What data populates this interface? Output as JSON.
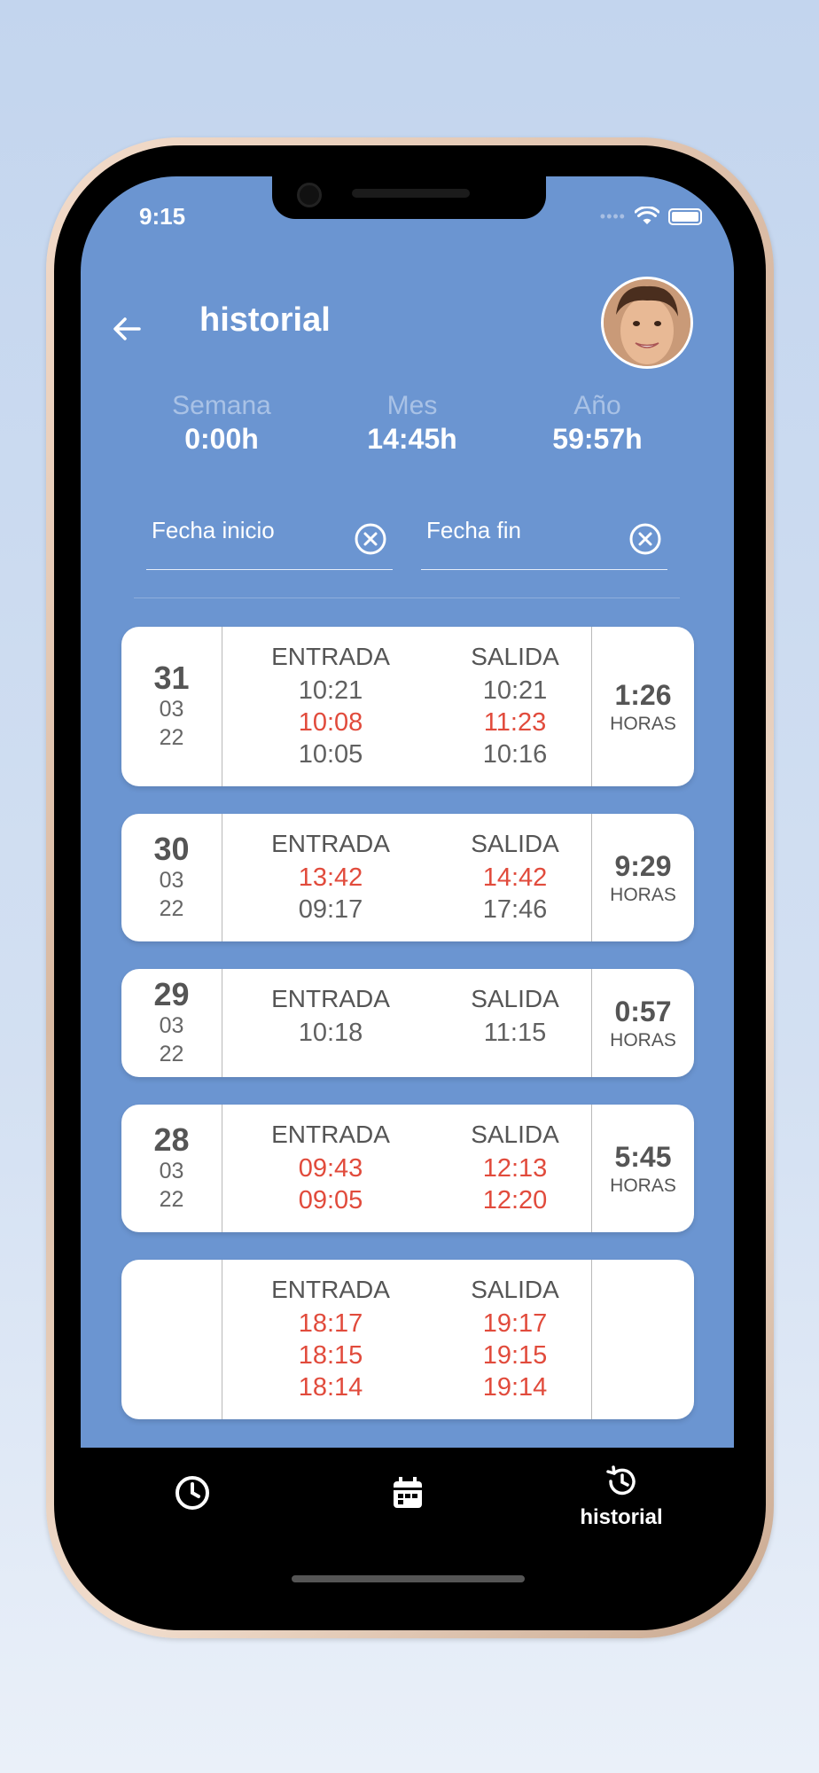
{
  "status_bar": {
    "time": "9:15",
    "signal": "••••"
  },
  "header": {
    "title": "historial"
  },
  "stats": [
    {
      "label": "Semana",
      "value": "0:00h"
    },
    {
      "label": "Mes",
      "value": "14:45h"
    },
    {
      "label": "Año",
      "value": "59:57h"
    }
  ],
  "filters": {
    "start_label": "Fecha inicio",
    "end_label": "Fecha fin"
  },
  "columns": {
    "in": "ENTRADA",
    "out": "SALIDA",
    "unit": "HORAS"
  },
  "records": [
    {
      "day": "31",
      "month": "03",
      "year": "22",
      "total": "1:26",
      "entries": [
        {
          "in": "10:21",
          "out": "10:21",
          "color": "gray"
        },
        {
          "in": "10:08",
          "out": "11:23",
          "color": "red"
        },
        {
          "in": "10:05",
          "out": "10:16",
          "color": "gray"
        }
      ]
    },
    {
      "day": "30",
      "month": "03",
      "year": "22",
      "total": "9:29",
      "entries": [
        {
          "in": "13:42",
          "out": "14:42",
          "color": "red"
        },
        {
          "in": "09:17",
          "out": "17:46",
          "color": "gray"
        }
      ]
    },
    {
      "day": "29",
      "month": "03",
      "year": "22",
      "total": "0:57",
      "entries": [
        {
          "in": "10:18",
          "out": "11:15",
          "color": "gray"
        }
      ]
    },
    {
      "day": "28",
      "month": "03",
      "year": "22",
      "total": "5:45",
      "entries": [
        {
          "in": "09:43",
          "out": "12:13",
          "color": "red"
        },
        {
          "in": "09:05",
          "out": "12:20",
          "color": "red"
        }
      ]
    },
    {
      "day": "",
      "month": "",
      "year": "",
      "total": "",
      "entries": [
        {
          "in": "18:17",
          "out": "19:17",
          "color": "red"
        },
        {
          "in": "18:15",
          "out": "19:15",
          "color": "red"
        },
        {
          "in": "18:14",
          "out": "19:14",
          "color": "red"
        }
      ]
    }
  ],
  "bottom_nav": {
    "items": [
      {
        "icon": "clock-icon",
        "label": ""
      },
      {
        "icon": "calendar-icon",
        "label": ""
      },
      {
        "icon": "history-icon",
        "label": "historial"
      }
    ]
  },
  "colors": {
    "background_blue": "#6b95d1",
    "late_red": "#e14b3c",
    "text_gray": "#555555"
  }
}
